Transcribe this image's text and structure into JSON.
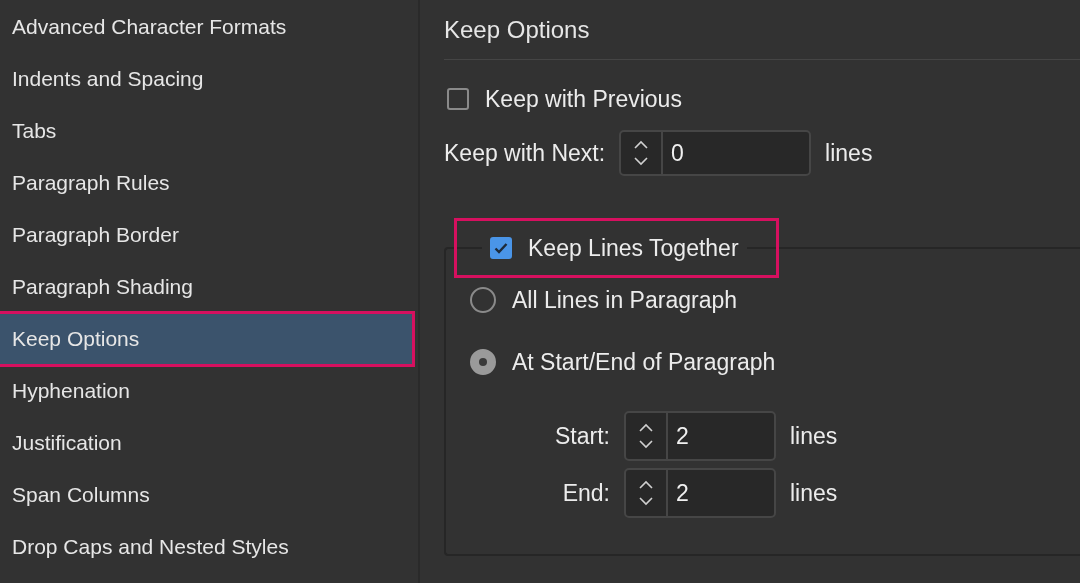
{
  "sidebar": {
    "items": [
      {
        "label": "Advanced Character Formats",
        "selected": false,
        "highlighted": false
      },
      {
        "label": "Indents and Spacing",
        "selected": false,
        "highlighted": false
      },
      {
        "label": "Tabs",
        "selected": false,
        "highlighted": false
      },
      {
        "label": "Paragraph Rules",
        "selected": false,
        "highlighted": false
      },
      {
        "label": "Paragraph Border",
        "selected": false,
        "highlighted": false
      },
      {
        "label": "Paragraph Shading",
        "selected": false,
        "highlighted": false
      },
      {
        "label": "Keep Options",
        "selected": true,
        "highlighted": true
      },
      {
        "label": "Hyphenation",
        "selected": false,
        "highlighted": false
      },
      {
        "label": "Justification",
        "selected": false,
        "highlighted": false
      },
      {
        "label": "Span Columns",
        "selected": false,
        "highlighted": false
      },
      {
        "label": "Drop Caps and Nested Styles",
        "selected": false,
        "highlighted": false
      }
    ]
  },
  "panel": {
    "title": "Keep Options",
    "keep_with_previous": {
      "label": "Keep with Previous",
      "checked": false
    },
    "keep_with_next": {
      "label": "Keep with Next:",
      "value": "0",
      "unit": "lines"
    },
    "keep_lines_together": {
      "label": "Keep Lines Together",
      "checked": true,
      "highlighted": true
    },
    "options": [
      {
        "label": "All Lines in Paragraph",
        "selected": false
      },
      {
        "label": "At Start/End of Paragraph",
        "selected": true
      }
    ],
    "fields": [
      {
        "label": "Start:",
        "value": "2",
        "unit": "lines"
      },
      {
        "label": "End:",
        "value": "2",
        "unit": "lines"
      }
    ]
  }
}
